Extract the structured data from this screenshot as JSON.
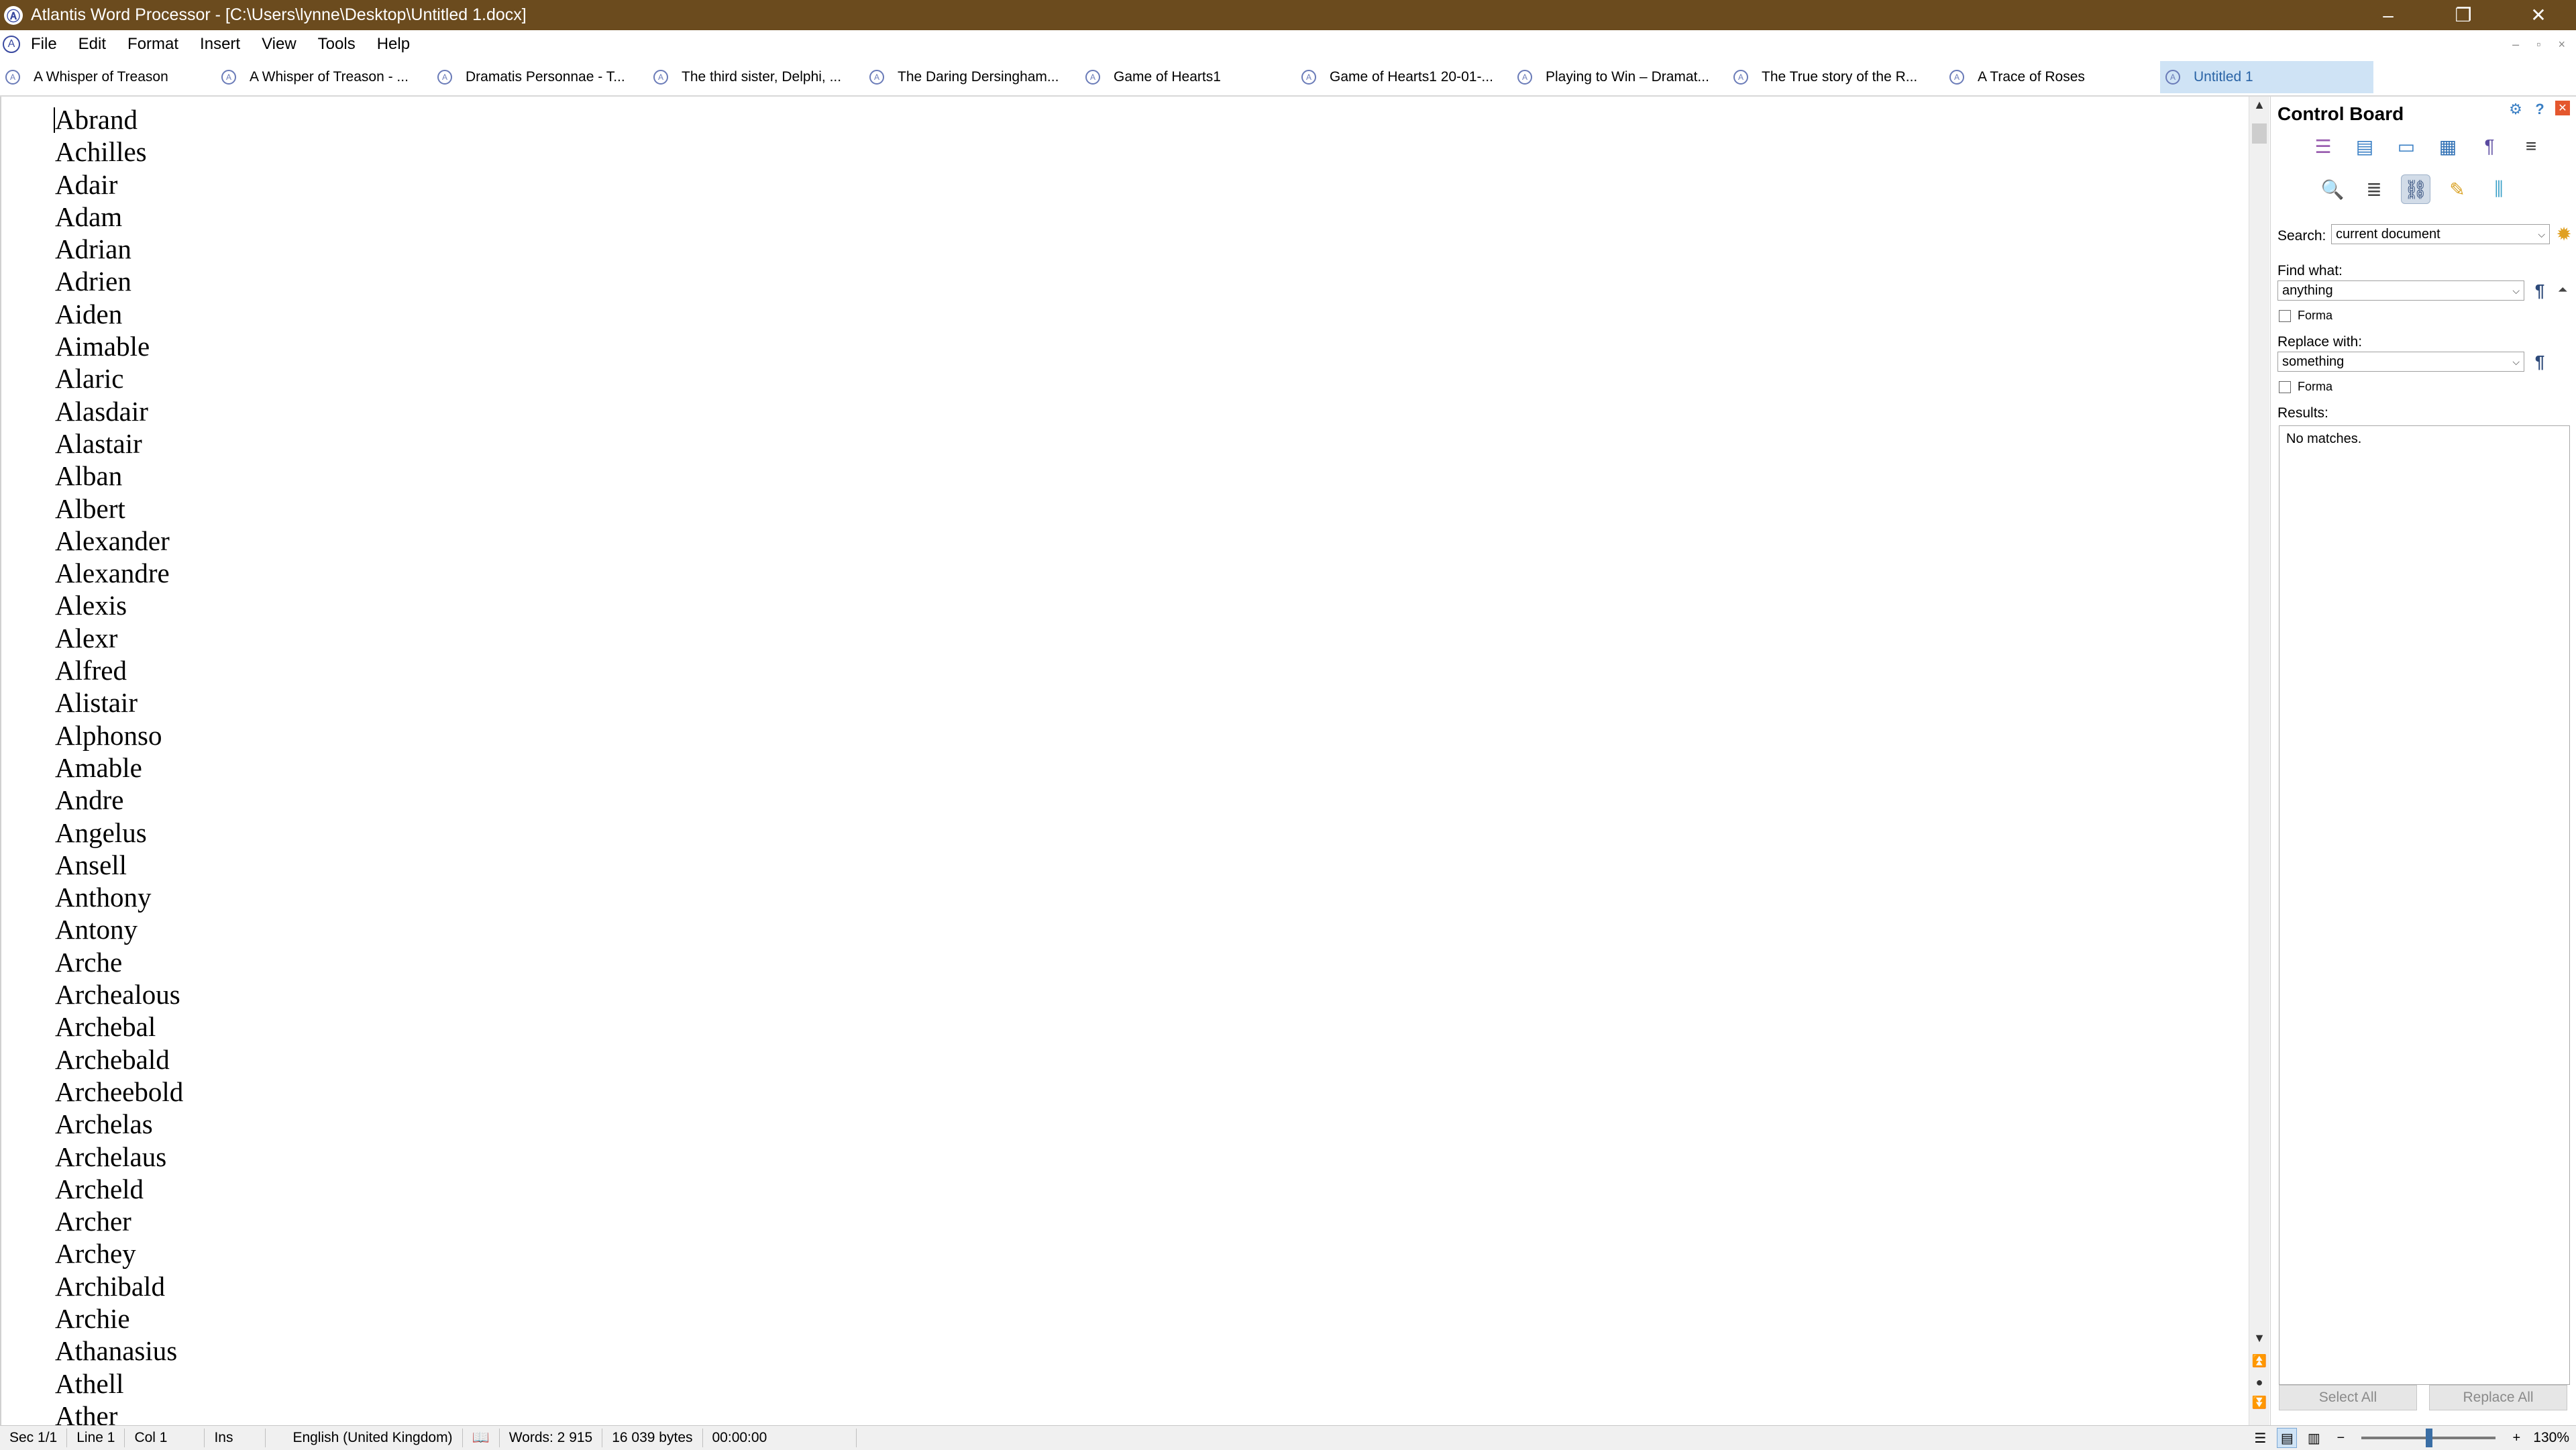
{
  "titlebar": {
    "title": "Atlantis Word Processor - [C:\\Users\\lynne\\Desktop\\Untitled 1.docx]",
    "minimize": "–",
    "restore": "❐",
    "close": "✕"
  },
  "menu": {
    "items": [
      "File",
      "Edit",
      "Format",
      "Insert",
      "View",
      "Tools",
      "Help"
    ]
  },
  "tabs": [
    "A Whisper of Treason",
    "A Whisper of Treason - ...",
    "Dramatis Personnae - T...",
    "The third sister, Delphi, ...",
    "The Daring Dersingham...",
    "Game of Hearts1",
    "Game of Hearts1 20-01-...",
    "Playing to Win – Dramat...",
    "The True story of the R...",
    "A Trace of Roses",
    "Untitled 1"
  ],
  "document": {
    "lines": [
      "Abrand",
      "Achilles",
      "Adair",
      "Adam",
      "Adrian",
      "Adrien",
      "Aiden",
      "Aimable",
      "Alaric",
      "Alasdair",
      "Alastair",
      "Alban",
      "Albert",
      "Alexander",
      "Alexandre",
      "Alexis",
      "Alexr",
      "Alfred",
      "Alistair",
      "Alphonso",
      "Amable",
      "Andre",
      "Angelus",
      "Ansell",
      "Anthony",
      "Antony",
      "Arche",
      "Archealous",
      "Archebal",
      "Archebald",
      "Archeebold",
      "Archelas",
      "Archelaus",
      "Archeld",
      "Archer",
      "Archey",
      "Archibald",
      "Archie",
      "Athanasius",
      "Athell",
      "Ather"
    ]
  },
  "control_board": {
    "title": "Control Board",
    "search_label": "Search:",
    "search_scope": "current document",
    "find_label": "Find what:",
    "find_value": "anything",
    "find_format": "Forma",
    "replace_label": "Replace with:",
    "replace_value": "something",
    "replace_format": "Forma",
    "results_label": "Results:",
    "results_text": "No matches.",
    "select_all": "Select All",
    "replace_all": "Replace All"
  },
  "statusbar": {
    "section": "Sec 1/1",
    "line": "Line 1",
    "col": "Col 1",
    "mode": "Ins",
    "language": "English (United Kingdom)",
    "words": "Words: 2 915",
    "bytes": "16 039 bytes",
    "time": "00:00:00",
    "zoom": "130%"
  },
  "colors": {
    "titlebar": "#6b4b1e",
    "active_tab": "#cfe3f5",
    "accent": "#3a6ea5"
  }
}
